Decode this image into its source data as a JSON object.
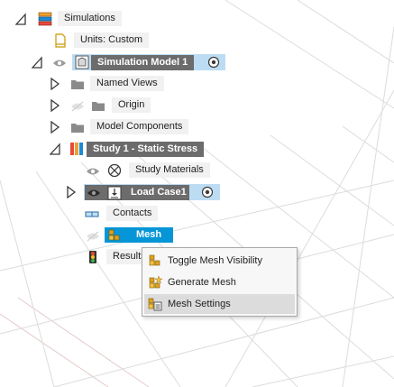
{
  "tree": {
    "root": {
      "label": "Simulations"
    },
    "units": {
      "label": "Units: Custom"
    },
    "model": {
      "label": "Simulation Model 1"
    },
    "named_views": {
      "label": "Named Views"
    },
    "origin": {
      "label": "Origin"
    },
    "model_components": {
      "label": "Model Components"
    },
    "study": {
      "label": "Study 1 - Static Stress"
    },
    "study_materials": {
      "label": "Study Materials"
    },
    "load_case": {
      "label": "Load Case1"
    },
    "contacts": {
      "label": "Contacts"
    },
    "mesh": {
      "label": "Mesh"
    },
    "results": {
      "label": "Results"
    }
  },
  "context_menu": {
    "items": [
      {
        "label": "Toggle Mesh Visibility",
        "icon": "mesh-visibility-icon"
      },
      {
        "label": "Generate Mesh",
        "icon": "generate-mesh-icon"
      },
      {
        "label": "Mesh Settings",
        "icon": "mesh-settings-icon"
      }
    ],
    "highlighted_index": 2
  },
  "colors": {
    "selected_dark": "#6c6c6c",
    "mesh_active": "#0696d7",
    "selection_row": "#bcdcf3",
    "menu_highlight": "#dcdcdc",
    "folder_gray": "#8a8a8a"
  }
}
